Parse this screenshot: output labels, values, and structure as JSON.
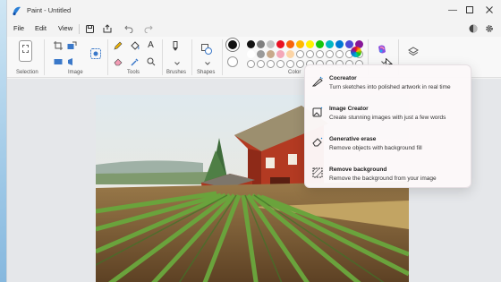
{
  "window": {
    "title": "Paint - Untitled"
  },
  "menu": {
    "file": "File",
    "edit": "Edit",
    "view": "View"
  },
  "ribbon": {
    "groups": {
      "selection": "Selection",
      "image": "Image",
      "tools": "Tools",
      "brushes": "Brushes",
      "shapes": "Shapes",
      "color": "Color"
    },
    "palette_row1": [
      "#111111",
      "#7f7f7f",
      "#c3c3c3",
      "#e81123",
      "#f7630c",
      "#ffb900",
      "#fff100",
      "#16c60c",
      "#00b7c3",
      "#0078d4",
      "#4f4bd6",
      "#881798"
    ],
    "palette_row2": [
      "#ffffff",
      "#9a9a9a",
      "#c8a98b",
      "#f4a7b9",
      "#fcd5a6",
      "#fde9a1",
      "#fdf9c4",
      "#b3e6a8",
      "#a7e7ef",
      "#99c9f0",
      "#b9b8ee",
      "#d7a6d9"
    ]
  },
  "copilot_menu": {
    "items": [
      {
        "title": "Cocreator",
        "desc": "Turn sketches into polished artwork in real time",
        "icon": "cocreator-icon"
      },
      {
        "title": "Image Creator",
        "desc": "Create stunning images with just a few words",
        "icon": "image-creator-icon"
      },
      {
        "title": "Generative erase",
        "desc": "Remove objects with background fill",
        "icon": "generative-erase-icon"
      },
      {
        "title": "Remove background",
        "desc": "Remove the background from your image",
        "icon": "remove-background-icon"
      }
    ]
  },
  "colors": {
    "accent": "#0078d4",
    "ribbon_bg": "#f8f8f8",
    "canvas_bg": "#e5e7ea"
  }
}
